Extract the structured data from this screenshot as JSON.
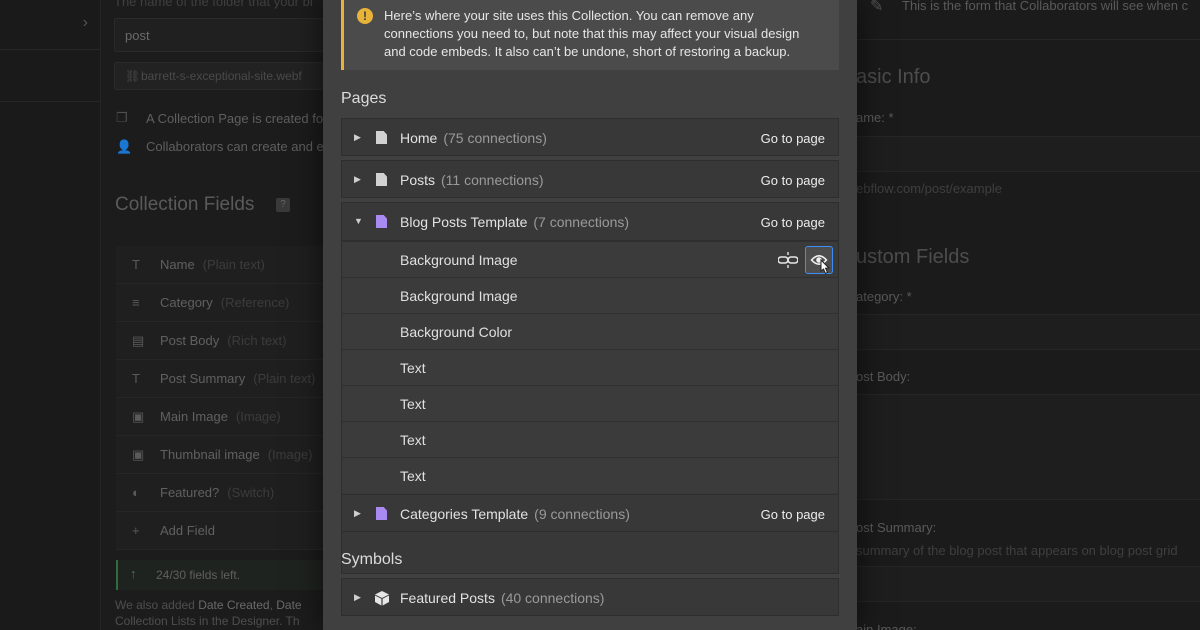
{
  "background": {
    "left_col": {
      "folder_hint": "The name of the folder that your bl",
      "slug_value": "post",
      "site_url": "barrett-s-exceptional-site.webf",
      "hint_page": "A Collection Page is created fo",
      "hint_collab": "Collaborators can create and e",
      "fields_title": "Collection Fields",
      "fields_help": "?",
      "fields": [
        {
          "name": "Name",
          "type": "(Plain text)",
          "icon": "T"
        },
        {
          "name": "Category",
          "type": "(Reference)",
          "icon": "≡"
        },
        {
          "name": "Post Body",
          "type": "(Rich text)",
          "icon": "▤"
        },
        {
          "name": "Post Summary",
          "type": "(Plain text)",
          "icon": "T"
        },
        {
          "name": "Main Image",
          "type": "(Image)",
          "icon": "▣"
        },
        {
          "name": "Thumbnail image",
          "type": "(Image)",
          "icon": "▣"
        },
        {
          "name": "Featured?",
          "type": "(Switch)",
          "icon": "◐"
        },
        {
          "name": "Add Field",
          "type": "",
          "icon": "+"
        }
      ],
      "fields_left": "24/30 fields left.",
      "footer_line1_prefix": "We also added",
      "footer_line1_b1": "Date Created",
      "footer_line1_b2": "Date",
      "footer_line2": "Collection Lists in the Designer. Th"
    },
    "right_col": {
      "form_hint": "This is the form that Collaborators will see when c",
      "basic_info": "asic Info",
      "name_label": "ame: *",
      "url_hint": "ebflow.com/post/example",
      "custom_fields": "ustom Fields",
      "category_label": "ategory: *",
      "post_body_label": "ost Body:",
      "post_summary_label": "ost Summary:",
      "post_summary_hint": "summary of the blog post that appears on blog post grid",
      "main_image_label": "ain Image:"
    }
  },
  "modal": {
    "notice": "Here’s where your site uses this Collection. You can remove any connections you need to, but note that this may affect your visual design and code embeds. It also can’t be undone, short of restoring a backup.",
    "pages_title": "Pages",
    "symbols_title": "Symbols",
    "go_to_page": "Go to page",
    "pages": [
      {
        "name": "Home",
        "connections": "(75 connections)"
      },
      {
        "name": "Posts",
        "connections": "(11 connections)"
      },
      {
        "name": "Blog Posts Template",
        "connections": "(7 connections)"
      },
      {
        "name": "Categories Template",
        "connections": "(9 connections)"
      }
    ],
    "blog_connections": [
      "Background Image",
      "Background Image",
      "Background Color",
      "Text",
      "Text",
      "Text",
      "Text"
    ],
    "symbols": [
      {
        "name": "Featured Posts",
        "connections": "(40 connections)"
      }
    ],
    "colors": {
      "accent_yellow": "#e8b339",
      "focus_blue": "#3d8ef7",
      "template_icon_purple": "#a98af0"
    }
  }
}
